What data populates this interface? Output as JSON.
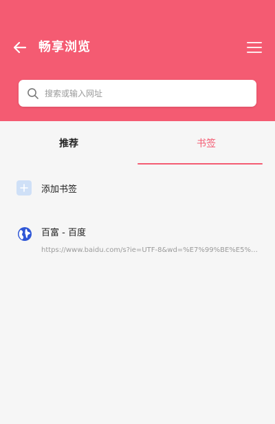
{
  "header": {
    "title": "畅享浏览",
    "back_icon": "arrow-left-icon",
    "menu_icon": "hamburger-menu-icon",
    "background": "#f45b72"
  },
  "search": {
    "placeholder": "搜索或输入网址",
    "value": "",
    "icon": "search-icon"
  },
  "tabs": [
    {
      "label": "推荐",
      "active": false
    },
    {
      "label": "书签",
      "active": true
    }
  ],
  "add_bookmark": {
    "label": "添加书签",
    "icon": "plus-icon",
    "icon_color": "#cfe0f7"
  },
  "bookmarks": [
    {
      "title": "百富 - 百度",
      "url": "https://www.baidu.com/s?ie=UTF-8&wd=%E7%99%BE%E5%AF%8...",
      "icon": "globe-icon"
    }
  ],
  "colors": {
    "accent": "#f45b72",
    "page_background": "#f6f6f6",
    "globe": "#2f57d6"
  }
}
